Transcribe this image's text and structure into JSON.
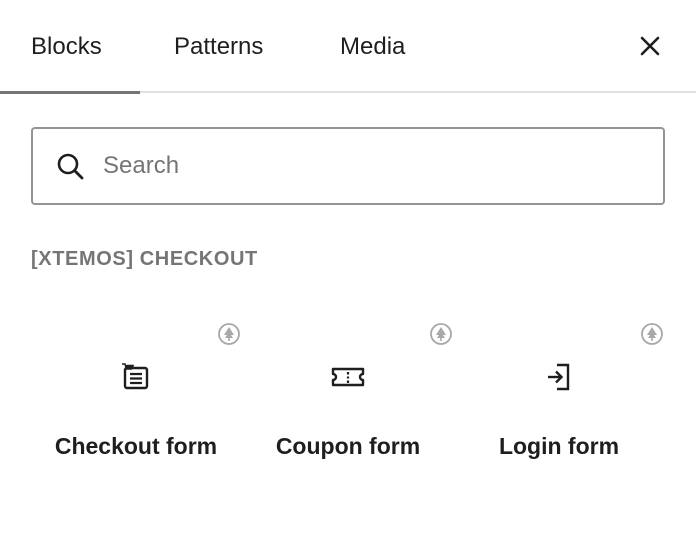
{
  "tabs": [
    {
      "label": "Blocks",
      "active": true
    },
    {
      "label": "Patterns",
      "active": false
    },
    {
      "label": "Media",
      "active": false
    }
  ],
  "close_icon": "close-icon",
  "search": {
    "placeholder": "Search",
    "value": "",
    "icon": "search-icon"
  },
  "category": {
    "title": "[XTEMOS] CHECKOUT"
  },
  "blocks": [
    {
      "label": "Checkout form",
      "icon": "checkout-form-icon",
      "badge_icon": "pine-tree-badge-icon"
    },
    {
      "label": "Coupon form",
      "icon": "coupon-ticket-icon",
      "badge_icon": "pine-tree-badge-icon"
    },
    {
      "label": "Login form",
      "icon": "login-arrow-icon",
      "badge_icon": "pine-tree-badge-icon"
    }
  ],
  "colors": {
    "text": "#1e1e1e",
    "muted": "#757575",
    "border": "#949494",
    "divider": "#e0e0e0",
    "badge": "#a8a8a8"
  }
}
